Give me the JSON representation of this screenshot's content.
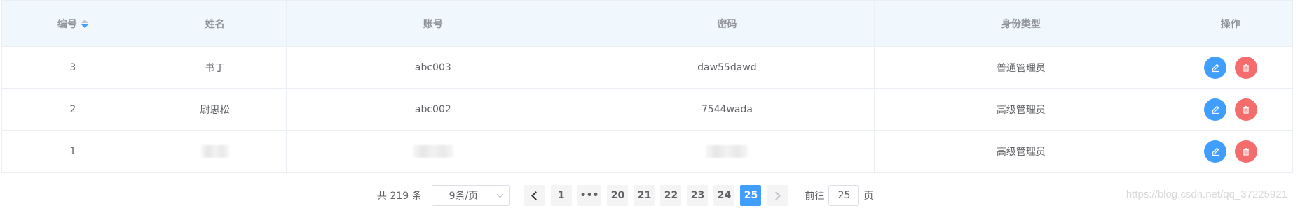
{
  "table": {
    "columns": {
      "id": "编号",
      "name": "姓名",
      "account": "账号",
      "password": "密码",
      "role": "身份类型",
      "actions": "操作"
    },
    "rows": [
      {
        "id": "3",
        "name": "书丁",
        "account": "abc003",
        "password": "daw55dawd",
        "role": "普通管理员"
      },
      {
        "id": "2",
        "name": "尉思松",
        "account": "abc002",
        "password": "7544wada",
        "role": "高级管理员"
      },
      {
        "id": "1",
        "name": "",
        "account": "",
        "password": "",
        "role": "高级管理员"
      }
    ]
  },
  "pagination": {
    "total_text": "共 219 条",
    "page_size": "9条/页",
    "pages": [
      "1",
      "•••",
      "20",
      "21",
      "22",
      "23",
      "24",
      "25"
    ],
    "current_page": "25",
    "jump_prefix": "前往",
    "jump_value": "25",
    "jump_suffix": "页"
  },
  "watermark": "https://blog.csdn.net/qq_37225921",
  "colors": {
    "accent": "#409eff",
    "danger": "#f56c6c",
    "header_bg": "#f0f7fd"
  },
  "icons": {
    "edit": "pencil-icon",
    "delete": "trash-icon",
    "sort": "sort-caret-icon"
  }
}
